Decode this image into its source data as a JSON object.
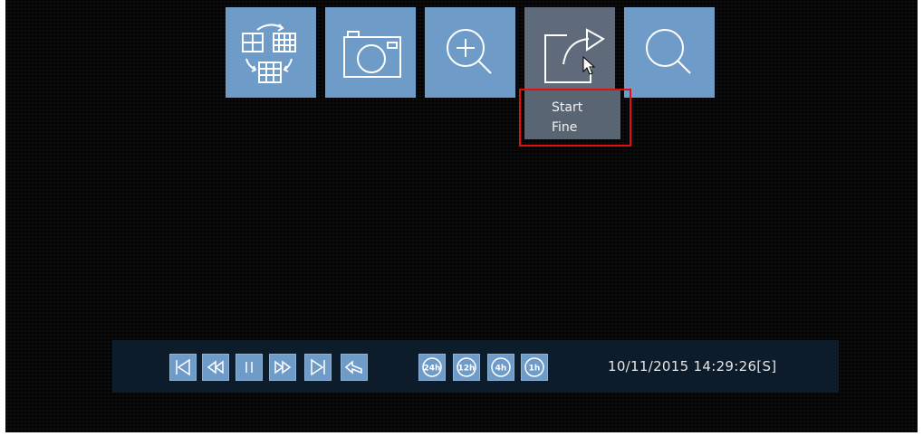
{
  "top_toolbar": {
    "buttons": [
      {
        "name": "layout-switch",
        "icon": "layout-switch-icon"
      },
      {
        "name": "snapshot",
        "icon": "camera-icon"
      },
      {
        "name": "zoom-in",
        "icon": "zoom-in-icon"
      },
      {
        "name": "export",
        "icon": "export-icon",
        "active": true
      },
      {
        "name": "search",
        "icon": "search-icon"
      }
    ],
    "tooltip": {
      "line1": "Start",
      "line2": "Fine"
    }
  },
  "playback_bar": {
    "controls": [
      "skip-to-start-icon",
      "rewind-icon",
      "pause-icon",
      "fast-forward-icon",
      "skip-to-end-icon",
      "return-icon"
    ],
    "time_ranges": [
      "24h",
      "12h",
      "4h",
      "1h"
    ],
    "datetime": "10/11/2015 14:29:26[S]"
  },
  "colors": {
    "button": "#6f9bc9",
    "active_button": "#5f6b7a",
    "bar_background": "#0d1c2b",
    "highlight": "#e01010"
  }
}
